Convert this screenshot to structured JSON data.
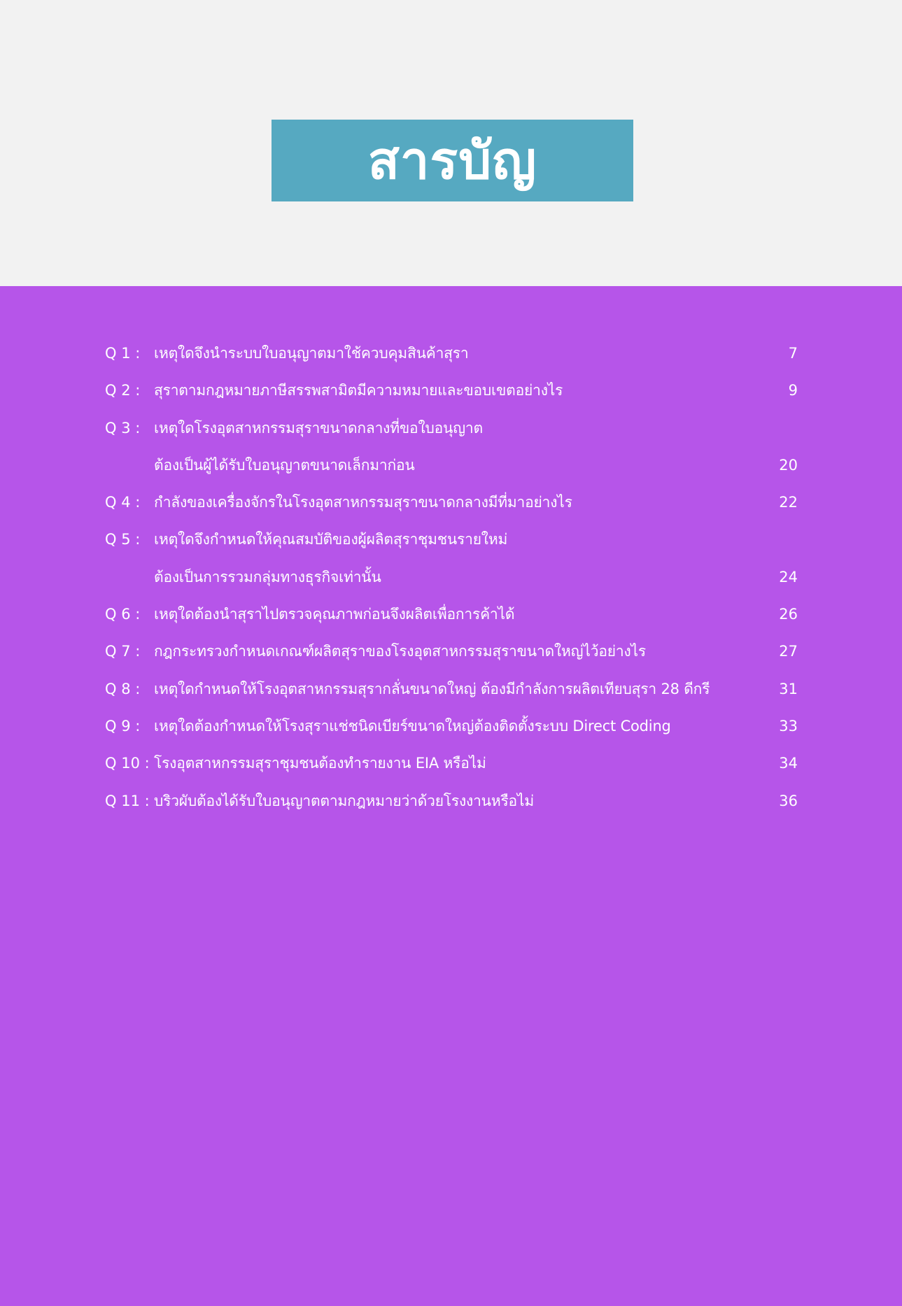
{
  "colors": {
    "header_bg": "#f2f2f2",
    "title_bg": "#56a9c1",
    "content_bg": "#b655e9",
    "text": "#ffffff"
  },
  "title": "สารบัญ",
  "toc": [
    {
      "label": "Q 1 :",
      "lines": [
        "เหตุใดจึงนำระบบใบอนุญาตมาใช้ควบคุมสินค้าสุรา"
      ],
      "page": "7"
    },
    {
      "label": "Q 2 :",
      "lines": [
        "สุราตามกฎหมายภาษีสรรพสามิตมีความหมายและขอบเขตอย่างไร"
      ],
      "page": "9"
    },
    {
      "label": "Q 3 :",
      "lines": [
        "เหตุใดโรงอุตสาหกรรมสุราขนาดกลางที่ขอใบอนุญาต",
        "ต้องเป็นผู้ได้รับใบอนุญาตขนาดเล็กมาก่อน"
      ],
      "page": "20"
    },
    {
      "label": "Q 4 :",
      "lines": [
        "กำลังของเครื่องจักรในโรงอุตสาหกรรมสุราขนาดกลางมีที่มาอย่างไร"
      ],
      "page": "22"
    },
    {
      "label": "Q 5 :",
      "lines": [
        "เหตุใดจึงกำหนดให้คุณสมบัติของผู้ผลิตสุราชุมชนรายใหม่",
        "ต้องเป็นการรวมกลุ่มทางธุรกิจเท่านั้น"
      ],
      "page": "24"
    },
    {
      "label": "Q 6 :",
      "lines": [
        "เหตุใดต้องนำสุราไปตรวจคุณภาพก่อนจึงผลิตเพื่อการค้าได้"
      ],
      "page": "26"
    },
    {
      "label": "Q 7 :",
      "lines": [
        "กฎกระทรวงกำหนดเกณฑ์ผลิตสุราของโรงอุตสาหกรรมสุราขนาดใหญ่ไว้อย่างไร"
      ],
      "page": "27"
    },
    {
      "label": "Q 8 :",
      "lines": [
        "เหตุใดกำหนดให้โรงอุตสาหกรรมสุรากลั่นขนาดใหญ่ ต้องมีกำลังการผลิตเทียบสุรา 28 ดีกรี"
      ],
      "page": "31"
    },
    {
      "label": "Q 9 :",
      "lines": [
        "เหตุใดต้องกำหนดให้โรงสุราแช่ชนิดเบียร์ขนาดใหญ่ต้องติดตั้งระบบ Direct Coding"
      ],
      "page": "33"
    },
    {
      "label": "Q 10 :",
      "lines": [
        "โรงอุตสาหกรรมสุราชุมชนต้องทำรายงาน EIA หรือไม่"
      ],
      "page": "34"
    },
    {
      "label": "Q 11 :",
      "lines": [
        "บริวผับต้องได้รับใบอนุญาตตามกฎหมายว่าด้วยโรงงานหรือไม่"
      ],
      "page": "36"
    }
  ]
}
